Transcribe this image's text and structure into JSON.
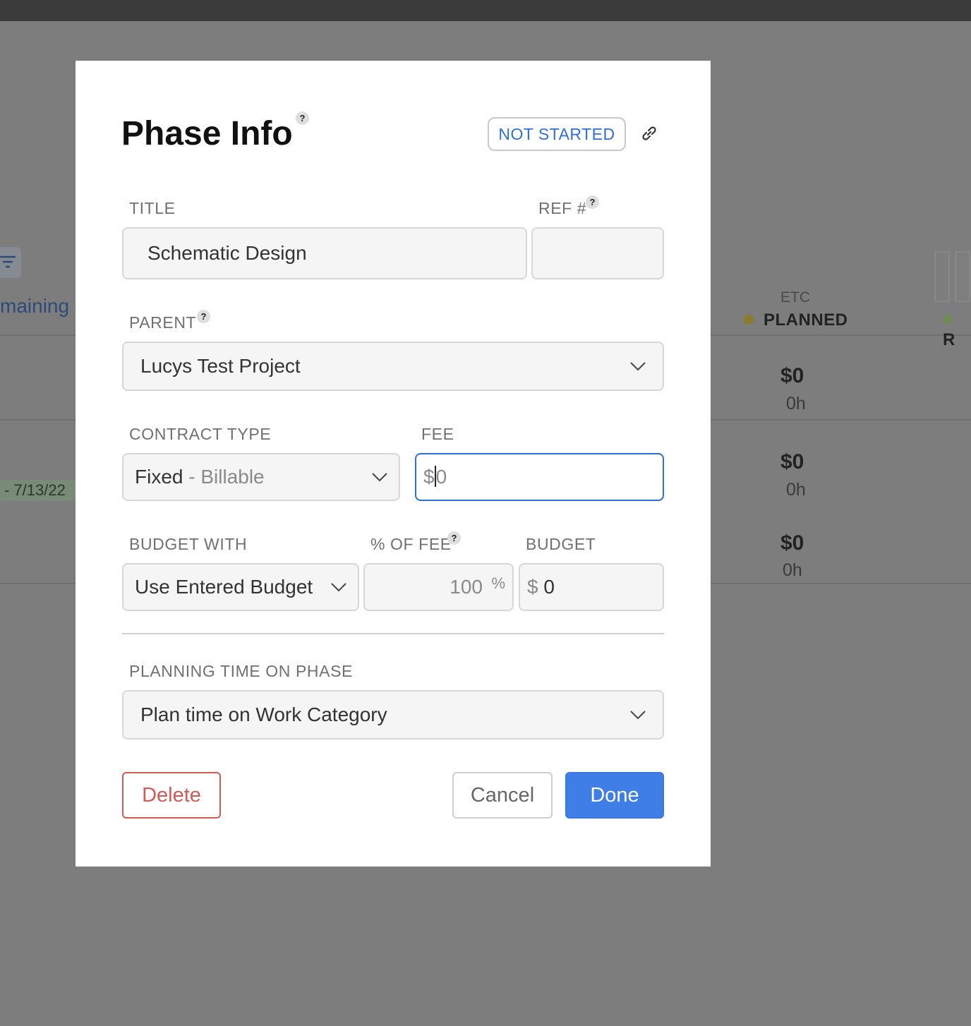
{
  "background": {
    "remaining_label": "maining",
    "date_label": "- 7/13/22",
    "etc_label": "ETC",
    "planned_label": "PLANNED",
    "r_label": "R",
    "rows": [
      {
        "amount": "$0",
        "hours": "0h"
      },
      {
        "amount": "$0",
        "hours": "0h"
      },
      {
        "amount": "$0",
        "hours": "0h"
      }
    ]
  },
  "modal": {
    "title": "Phase Info",
    "help": "?",
    "status": "NOT STARTED",
    "title_field": {
      "label": "TITLE",
      "value": "Schematic Design"
    },
    "ref_field": {
      "label": "REF #",
      "value": ""
    },
    "parent_field": {
      "label": "PARENT",
      "value": "Lucys Test Project"
    },
    "contract_type": {
      "label": "CONTRACT TYPE",
      "value": "Fixed",
      "suffix": "- Billable"
    },
    "fee": {
      "label": "FEE",
      "currency": "$",
      "value": "0"
    },
    "budget_with": {
      "label": "BUDGET WITH",
      "value": "Use Entered Budget"
    },
    "pct_of_fee": {
      "label": "% OF FEE",
      "value": "100",
      "unit": "%"
    },
    "budget": {
      "label": "BUDGET",
      "currency": "$",
      "value": "0"
    },
    "planning": {
      "label": "PLANNING TIME ON PHASE",
      "value": "Plan time on Work Category"
    },
    "buttons": {
      "delete": "Delete",
      "cancel": "Cancel",
      "done": "Done"
    }
  },
  "colors": {
    "accent": "#3f7ee6",
    "status_text": "#2f6fdc",
    "delete": "#d35a55"
  }
}
